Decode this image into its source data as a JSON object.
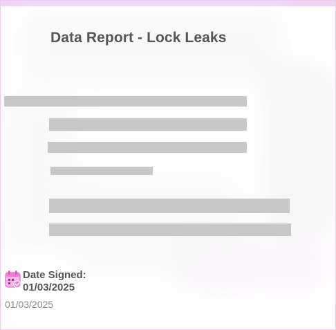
{
  "document": {
    "title": "Data Report - Lock Leaks"
  },
  "signature": {
    "label": "Date Signed:",
    "value": "01/03/2025",
    "date_below": "01/03/2025",
    "icon": "calendar-check-icon"
  },
  "colors": {
    "border": "#f1c6f0",
    "topbar": "#ead6f5",
    "redaction": "#c8c8c8",
    "text": "#555555",
    "muted_text": "#8a8a8a",
    "icon_pink": "#f27ad8"
  }
}
